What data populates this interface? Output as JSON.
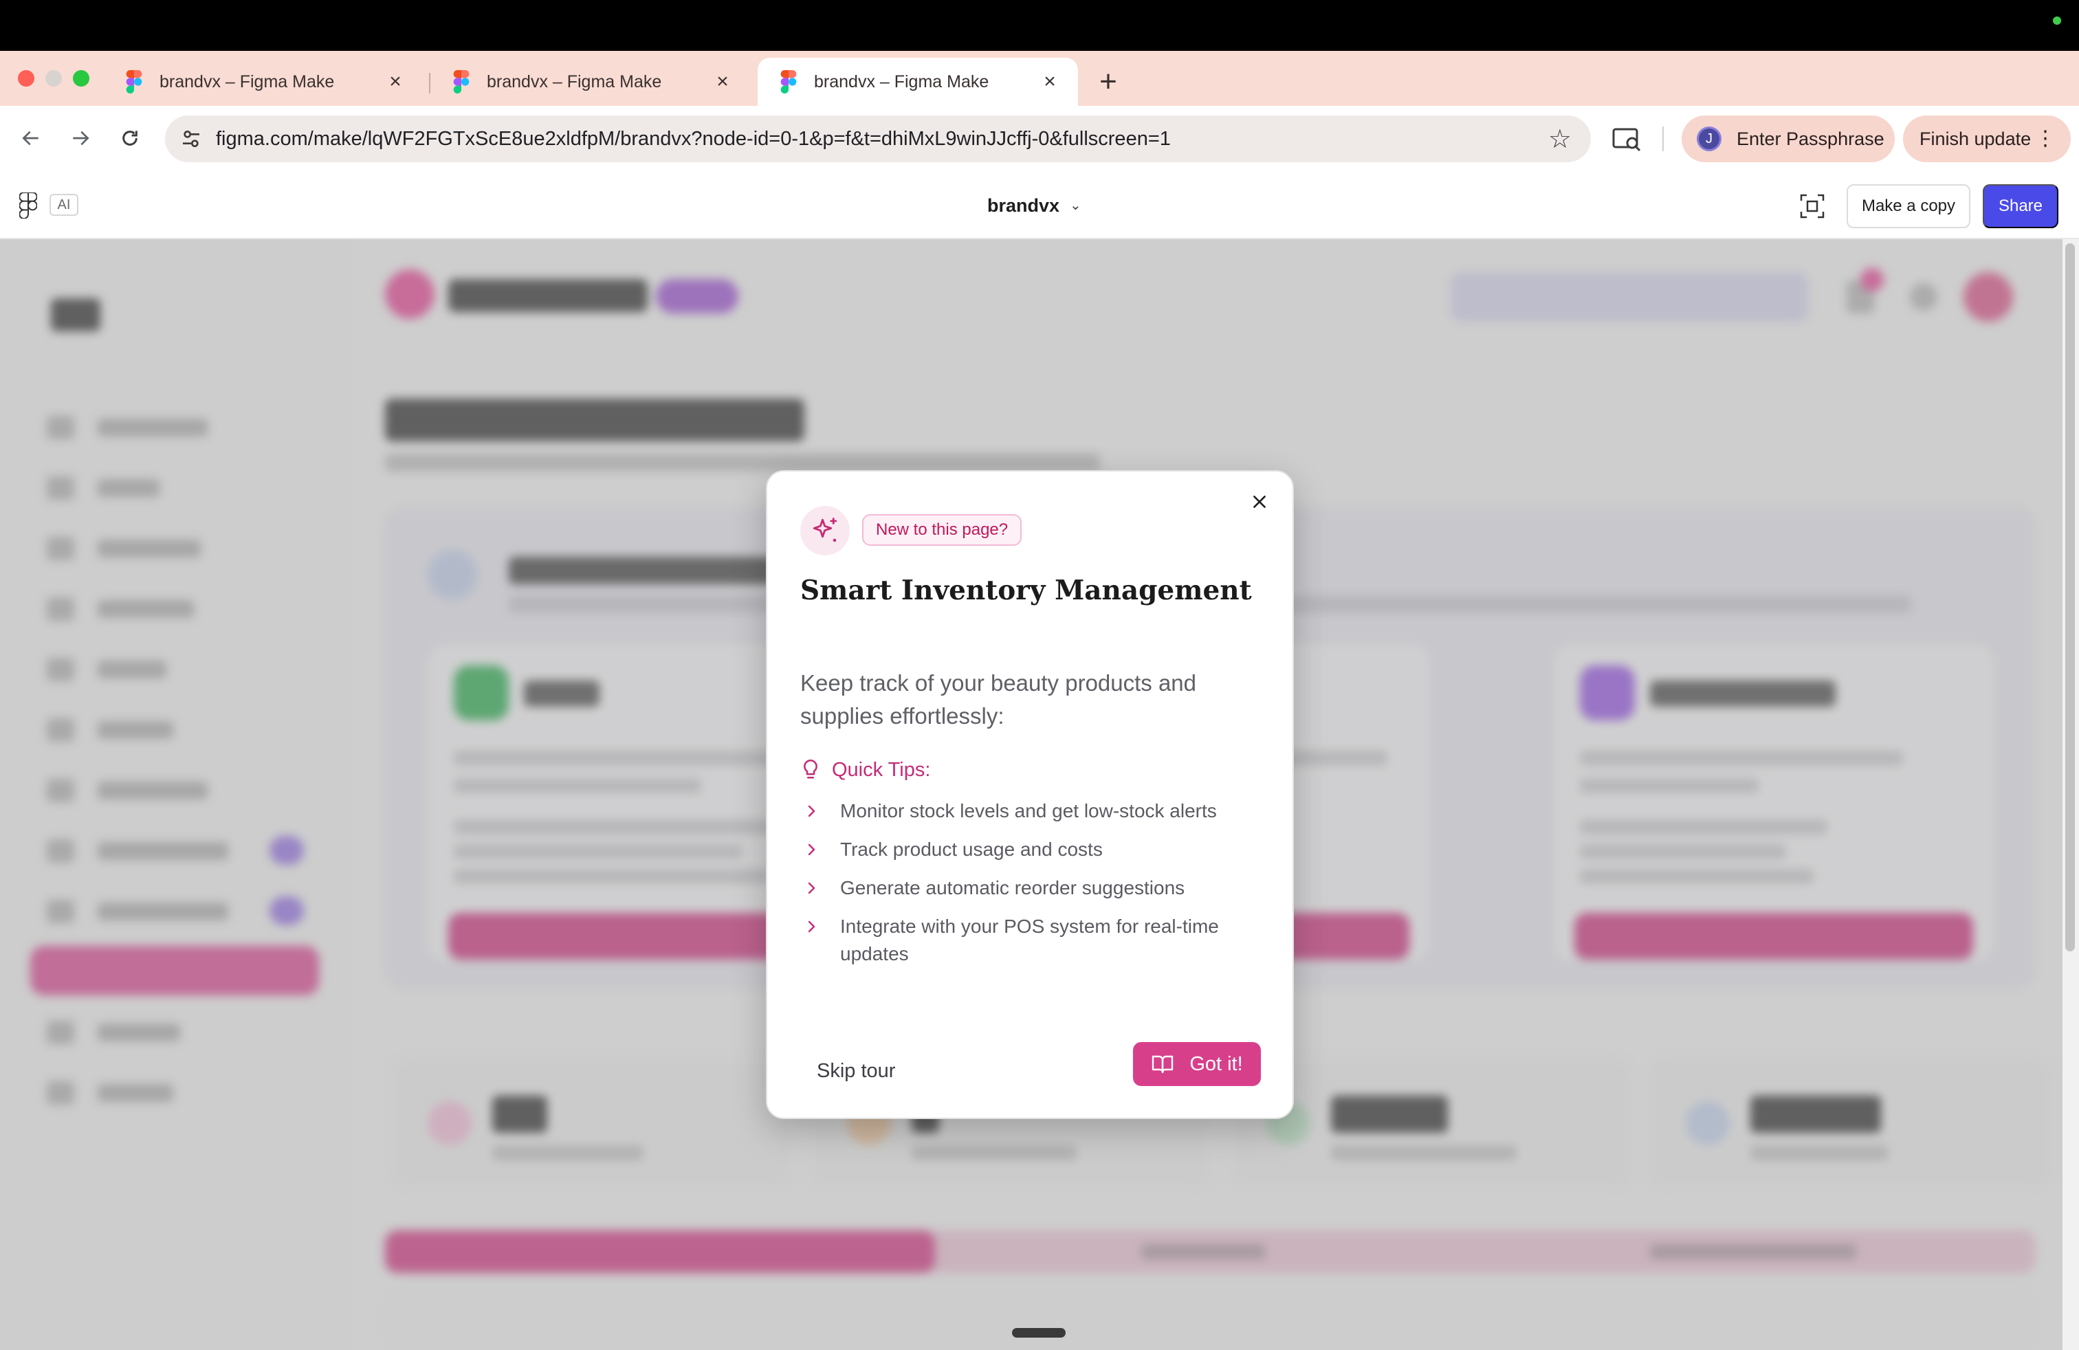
{
  "browser": {
    "tabs": [
      {
        "title": "brandvx – Figma Make",
        "active": false
      },
      {
        "title": "brandvx – Figma Make",
        "active": false
      },
      {
        "title": "brandvx – Figma Make",
        "active": true
      }
    ],
    "new_tab_icon": "plus-icon",
    "url": "figma.com/make/lqWF2FGTxScE8ue2xldfpM/brandvx?node-id=0-1&p=f&t=dhiMxL9winJJcffj-0&fullscreen=1",
    "profile_initial": "J",
    "passphrase_label": "Enter Passphrase",
    "finish_update_label": "Finish update"
  },
  "figma": {
    "ai_badge": "AI",
    "file_name": "brandvx",
    "make_copy_label": "Make a copy",
    "share_label": "Share"
  },
  "modal": {
    "badge": "New to this page?",
    "title": "Smart Inventory Management",
    "description": "Keep track of your beauty products and supplies effortlessly:",
    "tips_heading": "Quick Tips:",
    "tips": [
      "Monitor stock levels and get low-stock alerts",
      "Track product usage and costs",
      "Generate automatic reorder suggestions",
      "Integrate with your POS system for real-time updates"
    ],
    "skip_label": "Skip tour",
    "got_it_label": "Got it!"
  },
  "colors": {
    "accent_pink": "#d83f8b",
    "figma_blue": "#4a4ae8",
    "tabstrip": "#f9dcd3"
  }
}
